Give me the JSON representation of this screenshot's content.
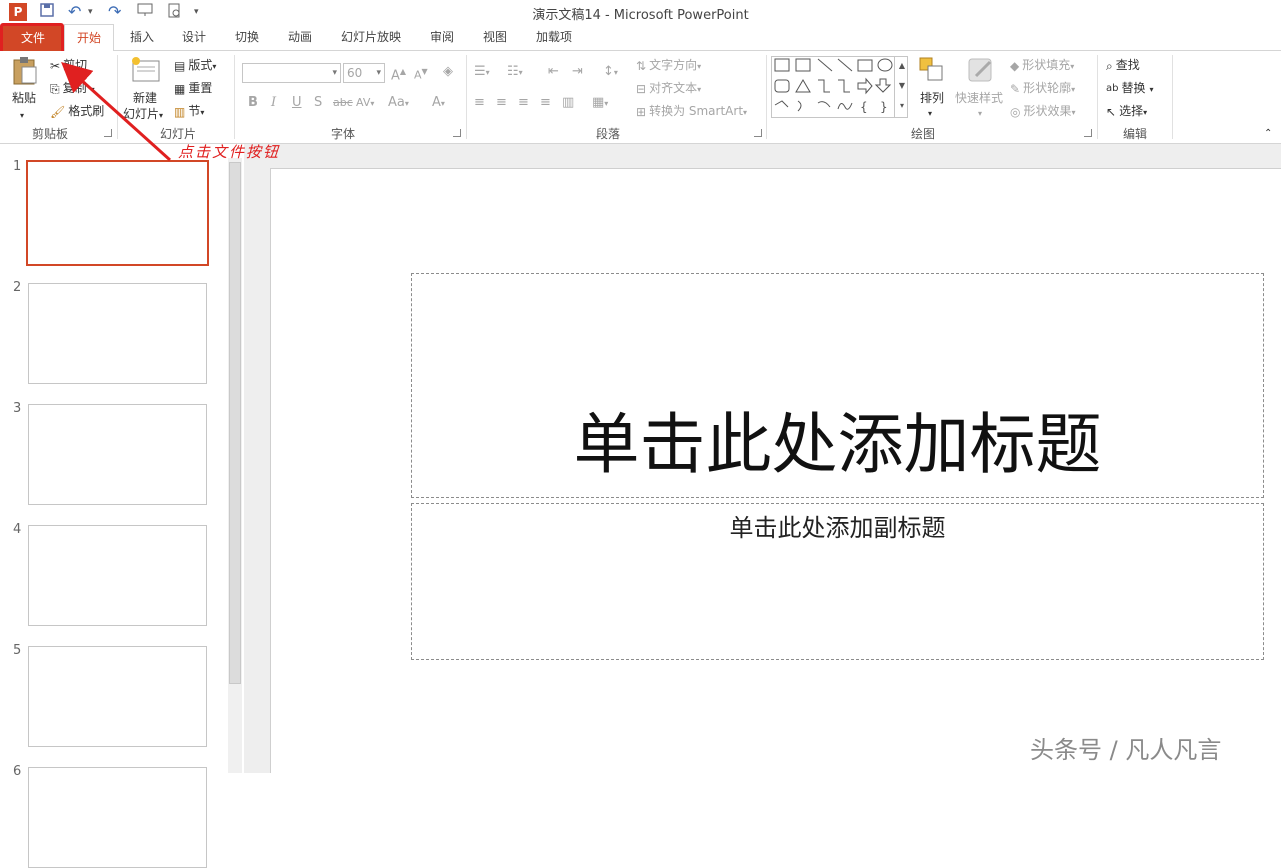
{
  "title_bar": {
    "title": "演示文稿14 - Microsoft PowerPoint"
  },
  "quick_access": [
    {
      "name": "powerpoint-logo-icon",
      "glyph": "P"
    },
    {
      "name": "save-icon",
      "glyph": "💾"
    },
    {
      "name": "undo-icon",
      "glyph": "↶"
    },
    {
      "name": "redo-icon",
      "glyph": "↷"
    },
    {
      "name": "present-from-start-icon",
      "glyph": "▣"
    },
    {
      "name": "print-preview-icon",
      "glyph": "🔍"
    },
    {
      "name": "customize-qat-icon",
      "glyph": "▾"
    }
  ],
  "tabs": {
    "file": "文件",
    "home": "开始",
    "insert": "插入",
    "design": "设计",
    "transitions": "切换",
    "animations": "动画",
    "slideshow": "幻灯片放映",
    "review": "审阅",
    "view": "视图",
    "addins": "加载项"
  },
  "ribbon": {
    "clipboard": {
      "label": "剪贴板",
      "paste": "粘贴",
      "cut": "剪切",
      "copy": "复制",
      "format_painter": "格式刷"
    },
    "slides": {
      "label": "幻灯片",
      "new_slide_1": "新建",
      "new_slide_2": "幻灯片",
      "layout": "版式",
      "reset": "重置",
      "section": "节"
    },
    "font": {
      "label": "字体",
      "font_size": "60",
      "bold": "B",
      "italic": "I",
      "underline": "U",
      "shadow": "S",
      "strike": "abc",
      "spacing": "AV",
      "case": "Aa",
      "grow": "A",
      "shrink": "A",
      "clear": "A",
      "color": "A"
    },
    "paragraph": {
      "label": "段落",
      "text_direction": "文字方向",
      "align_text": "对齐文本",
      "smartart": "转换为 SmartArt"
    },
    "drawing": {
      "label": "绘图",
      "arrange": "排列",
      "quick_styles": "快速样式",
      "shape_fill": "形状填充",
      "shape_outline": "形状轮廓",
      "shape_effects": "形状效果"
    },
    "editing": {
      "label": "编辑",
      "find": "查找",
      "replace": "替换",
      "select": "选择"
    }
  },
  "annotation": {
    "text": "点击文件按钮",
    "color": "#e02020"
  },
  "thumbnails": [
    "1",
    "2",
    "3",
    "4",
    "5",
    "6"
  ],
  "slide": {
    "title_placeholder": "单击此处添加标题",
    "subtitle_placeholder": "单击此处添加副标题"
  },
  "watermark": "头条号 / 凡人凡言",
  "colors": {
    "accent": "#d24726",
    "annotation": "#e02020"
  }
}
